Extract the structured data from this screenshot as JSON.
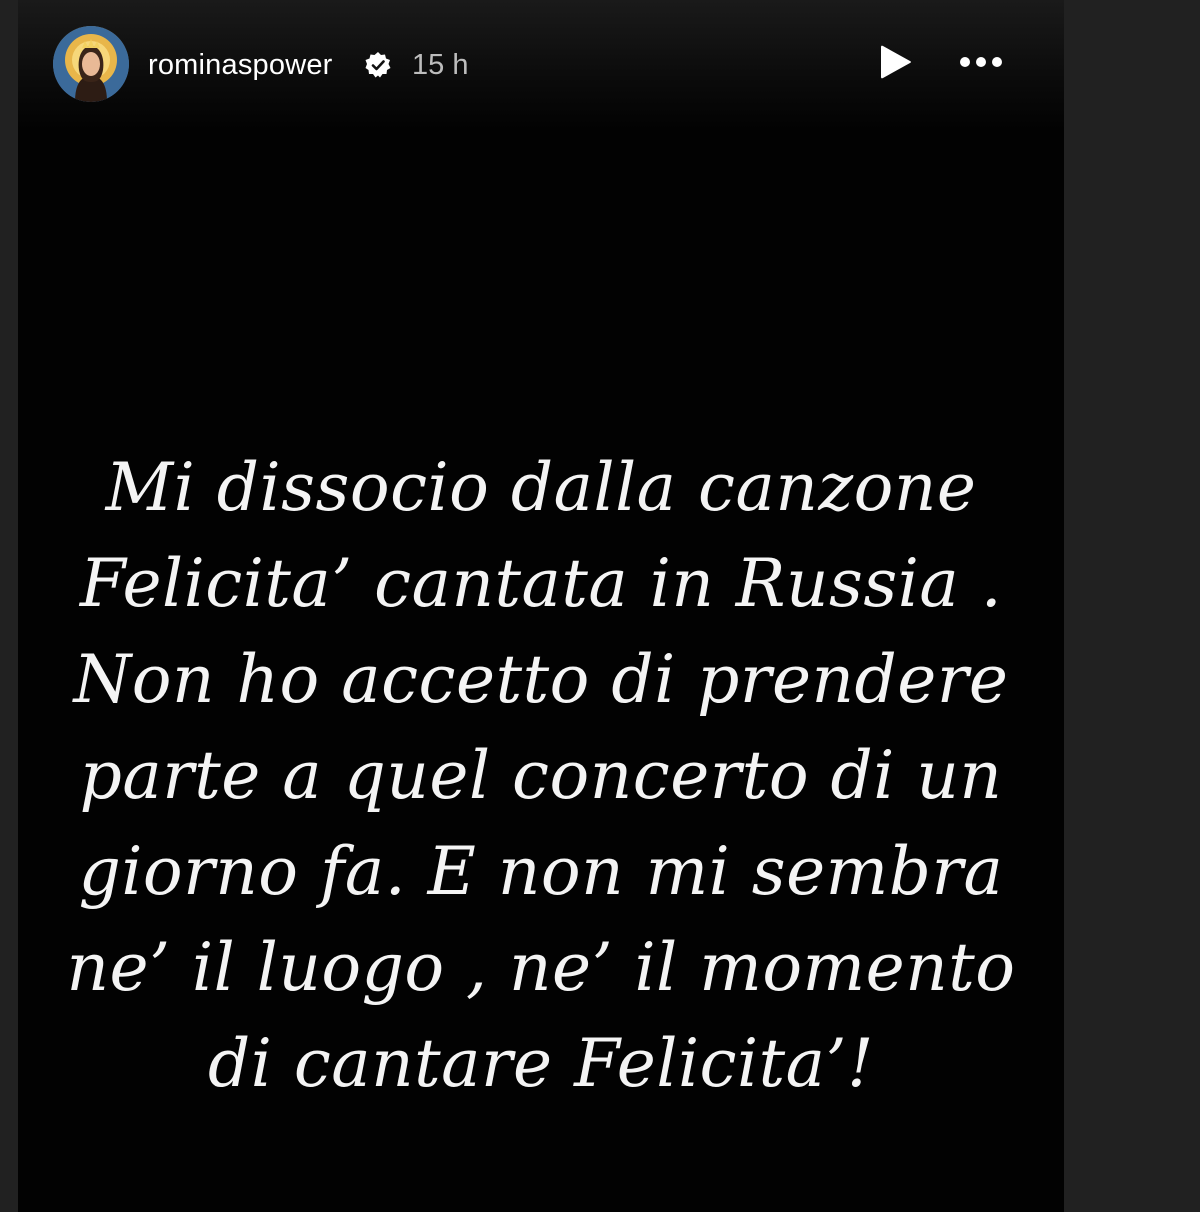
{
  "story": {
    "background_color": "#020202",
    "header": {
      "avatar_icon": "profile-avatar-icon",
      "username": "rominaspower",
      "verified_icon": "verified-badge-icon",
      "timestamp": "15 h",
      "play_icon": "play-icon",
      "more_icon": "more-options-icon"
    },
    "message": {
      "lines": [
        "Mi dissocio dalla canzone",
        "Felicita’ cantata in Russia .",
        "Non ho accetto di prendere",
        "parte a quel concerto di un",
        "giorno fa. E non mi sembra",
        "ne’ il luogo , ne’ il momento",
        "di cantare Felicita’!"
      ]
    }
  }
}
